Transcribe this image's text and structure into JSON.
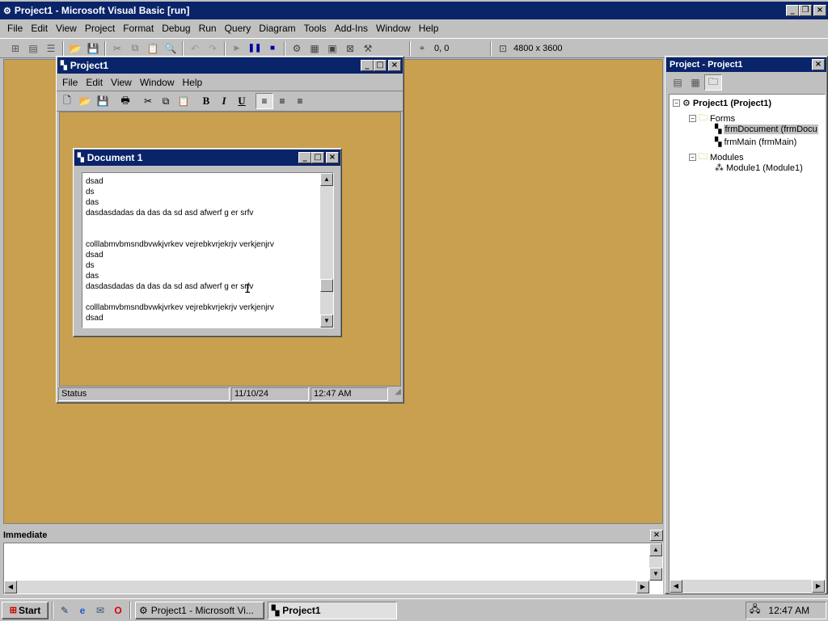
{
  "app": {
    "title": "Project1 - Microsoft Visual Basic [run]",
    "menu": [
      "File",
      "Edit",
      "View",
      "Project",
      "Format",
      "Debug",
      "Run",
      "Query",
      "Diagram",
      "Tools",
      "Add-Ins",
      "Window",
      "Help"
    ],
    "toolbar": {
      "position": "0, 0",
      "size": "4800 x 3600"
    }
  },
  "project_window": {
    "title": "Project1",
    "menu": [
      "File",
      "Edit",
      "View",
      "Window",
      "Help"
    ],
    "status": {
      "label": "Status",
      "date": "11/10/24",
      "time": "12:47 AM"
    }
  },
  "document_window": {
    "title": "Document 1",
    "lines": [
      "dsad",
      "ds",
      "das",
      "dasdasdadas da das da sd asd afwerf g er srfv",
      "",
      "",
      "colllabmvbmsndbvwkjvrkev vejrebkvrjekrjv verkjenjrv",
      "dsad",
      "ds",
      "das",
      "dasdasdadas da das da sd asd afwerf g er srfv",
      "",
      "colllabmvbmsndbvwkjvrkev vejrebkvrjekrjv verkjenjrv",
      "dsad"
    ]
  },
  "project_explorer": {
    "title": "Project - Project1",
    "root": "Project1 (Project1)",
    "forms_label": "Forms",
    "forms": [
      "frmDocument (frmDocu",
      "frmMain (frmMain)"
    ],
    "modules_label": "Modules",
    "modules": [
      "Module1 (Module1)"
    ]
  },
  "immediate": {
    "title": "Immediate"
  },
  "taskbar": {
    "start": "Start",
    "tasks": [
      "Project1 - Microsoft Vi...",
      "Project1"
    ],
    "clock": "12:47 AM"
  },
  "colors": {
    "desktop": "#c8a050",
    "title_active": "#0a246a",
    "face": "#c0c0c0"
  }
}
